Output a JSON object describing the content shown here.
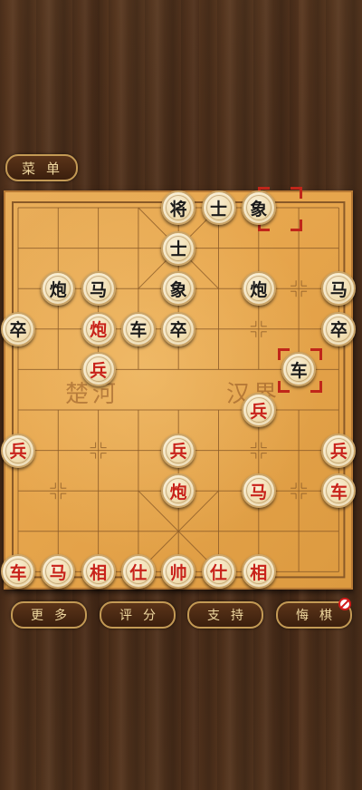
{
  "menu": {
    "label": "菜单"
  },
  "river": {
    "left": "楚河",
    "right": "汉界"
  },
  "pieces": [
    {
      "text": "将",
      "side": "black",
      "col": 4,
      "row": 0
    },
    {
      "text": "士",
      "side": "black",
      "col": 5,
      "row": 0
    },
    {
      "text": "象",
      "side": "black",
      "col": 6,
      "row": 0
    },
    {
      "text": "士",
      "side": "black",
      "col": 4,
      "row": 1
    },
    {
      "text": "炮",
      "side": "black",
      "col": 1,
      "row": 2
    },
    {
      "text": "马",
      "side": "black",
      "col": 2,
      "row": 2
    },
    {
      "text": "象",
      "side": "black",
      "col": 4,
      "row": 2
    },
    {
      "text": "炮",
      "side": "black",
      "col": 6,
      "row": 2
    },
    {
      "text": "马",
      "side": "black",
      "col": 8,
      "row": 2
    },
    {
      "text": "卒",
      "side": "black",
      "col": 0,
      "row": 3
    },
    {
      "text": "炮",
      "side": "red",
      "col": 2,
      "row": 3
    },
    {
      "text": "车",
      "side": "black",
      "col": 3,
      "row": 3
    },
    {
      "text": "卒",
      "side": "black",
      "col": 4,
      "row": 3
    },
    {
      "text": "卒",
      "side": "black",
      "col": 8,
      "row": 3
    },
    {
      "text": "兵",
      "side": "red",
      "col": 2,
      "row": 4
    },
    {
      "text": "车",
      "side": "black",
      "col": 7,
      "row": 4
    },
    {
      "text": "兵",
      "side": "red",
      "col": 6,
      "row": 5
    },
    {
      "text": "兵",
      "side": "red",
      "col": 0,
      "row": 6
    },
    {
      "text": "兵",
      "side": "red",
      "col": 4,
      "row": 6
    },
    {
      "text": "兵",
      "side": "red",
      "col": 8,
      "row": 6
    },
    {
      "text": "炮",
      "side": "red",
      "col": 4,
      "row": 7
    },
    {
      "text": "马",
      "side": "red",
      "col": 6,
      "row": 7
    },
    {
      "text": "车",
      "side": "red",
      "col": 8,
      "row": 7
    },
    {
      "text": "车",
      "side": "red",
      "col": 0,
      "row": 9
    },
    {
      "text": "马",
      "side": "red",
      "col": 1,
      "row": 9
    },
    {
      "text": "相",
      "side": "red",
      "col": 2,
      "row": 9
    },
    {
      "text": "仕",
      "side": "red",
      "col": 3,
      "row": 9
    },
    {
      "text": "帅",
      "side": "red",
      "col": 4,
      "row": 9
    },
    {
      "text": "仕",
      "side": "red",
      "col": 5,
      "row": 9
    },
    {
      "text": "相",
      "side": "red",
      "col": 6,
      "row": 9
    }
  ],
  "last_move_markers": [
    {
      "col": 6.5,
      "row": 0
    },
    {
      "col": 7,
      "row": 4
    }
  ],
  "bottom_buttons": {
    "more": "更多",
    "rate": "评分",
    "support": "支持",
    "undo": "悔棋"
  },
  "icons": {
    "undo_badge": "no-entry-icon"
  },
  "colors": {
    "red_piece": "#c8221a",
    "black_piece": "#1b1b1b",
    "board": "#e7a64d",
    "button_text": "#f0d9a0"
  }
}
